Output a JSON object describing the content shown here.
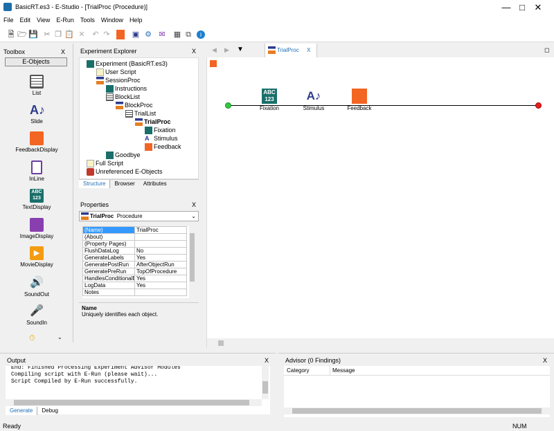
{
  "window": {
    "title": "BasicRT.es3 - E-Studio - [TrialProc  (Procedure)]",
    "min_icon": "minimize-icon",
    "max_icon": "maximize-icon",
    "close_icon": "close-icon"
  },
  "menu": [
    "File",
    "Edit",
    "View",
    "E-Run",
    "Tools",
    "Window",
    "Help"
  ],
  "toolbox": {
    "title": "Toolbox",
    "close": "X",
    "section": "E-Objects",
    "items": [
      "List",
      "Slide",
      "FeedbackDisplay",
      "InLine",
      "TextDisplay",
      "ImageDisplay",
      "MovieDisplay",
      "SoundOut",
      "SoundIn"
    ]
  },
  "explorer": {
    "title": "Experiment Explorer",
    "close": "X",
    "tree": [
      "Experiment (BasicRT.es3)",
      "User Script",
      "SessionProc",
      "Instructions",
      "BlockList",
      "BlockProc",
      "TrialList",
      "TrialProc",
      "Fixation",
      "Stimulus",
      "Feedback",
      "Goodbye",
      "Full Script",
      "Unreferenced E-Objects"
    ],
    "tabs": [
      "Structure",
      "Browser",
      "Attributes"
    ]
  },
  "properties": {
    "title": "Properties",
    "close": "X",
    "object_name": "TrialProc",
    "object_type": "Procedure",
    "rows": [
      [
        "(Name)",
        "TrialProc"
      ],
      [
        "(About)",
        ""
      ],
      [
        "(Property Pages)",
        ""
      ],
      [
        "FlushDataLog",
        "No"
      ],
      [
        "GenerateLabels",
        "Yes"
      ],
      [
        "GeneratePostRun",
        "AfterObjectRun"
      ],
      [
        "GeneratePreRun",
        "TopOfProcedure"
      ],
      [
        "HandlesConditionalExi",
        "Yes"
      ],
      [
        "LogData",
        "Yes"
      ],
      [
        "Notes",
        ""
      ]
    ],
    "desc_title": "Name",
    "desc_text": "Uniquely identifies each object."
  },
  "workspace": {
    "tab": "TrialProc",
    "tab_close": "X",
    "objects": [
      "Fixation",
      "Stimulus",
      "Feedback"
    ]
  },
  "output": {
    "title": "Output",
    "close": "X",
    "lines": [
      "End:  Finished Processing Experiment Advisor Modules",
      "",
      "Compiling script with E-Run (please wait)...",
      "Script Compiled by E-Run successfully."
    ],
    "tabs": [
      "Generate",
      "Debug"
    ]
  },
  "advisor": {
    "title": "Advisor (0 Findings)",
    "close": "X",
    "columns": [
      "Category",
      "Message"
    ]
  },
  "status": {
    "left": "Ready",
    "num": "NUM"
  }
}
